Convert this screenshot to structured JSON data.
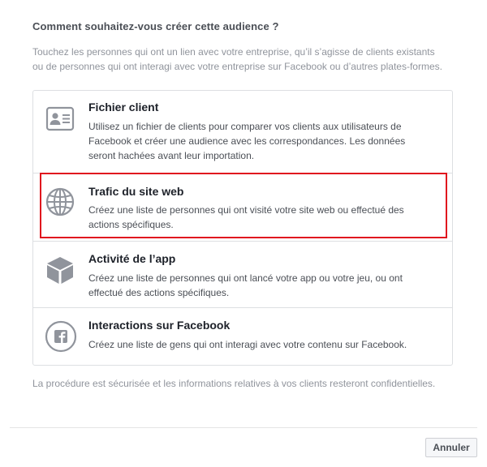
{
  "dialog": {
    "title": "Comment souhaitez-vous créer cette audience ?",
    "intro_line1": "Touchez les personnes qui ont un lien avec votre entreprise, qu’il s’agisse de clients existants",
    "intro_line2": "ou de personnes qui ont interagi avec votre entreprise sur Facebook ou d’autres plates-formes."
  },
  "options": [
    {
      "icon": "contact-card-icon",
      "title": "Fichier client",
      "desc_line1": "Utilisez un fichier de clients pour comparer vos clients aux utilisateurs de",
      "desc_line2": "Facebook et créer une audience avec les correspondances. Les données",
      "desc_line3": "seront hachées avant leur importation."
    },
    {
      "icon": "globe-icon",
      "title": "Trafic du site web",
      "desc_line1": "Créez une liste de personnes qui ont visité votre site web ou effectué des",
      "desc_line2": "actions spécifiques."
    },
    {
      "icon": "cube-icon",
      "title": "Activité de l’app",
      "desc_line1": "Créez une liste de personnes qui ont lancé votre app ou votre jeu, ou ont",
      "desc_line2": "effectué des actions spécifiques."
    },
    {
      "icon": "facebook-icon",
      "title": "Interactions sur Facebook",
      "desc_line1": "Créez une liste de gens qui ont interagi avec votre contenu sur Facebook."
    }
  ],
  "footer": {
    "note": "La procédure est sécurisée et les informations relatives à vos clients resteront confidentielles.",
    "cancel_label": "Annuler"
  },
  "colors": {
    "highlight": "#e0141e",
    "icon": "#90949c"
  }
}
